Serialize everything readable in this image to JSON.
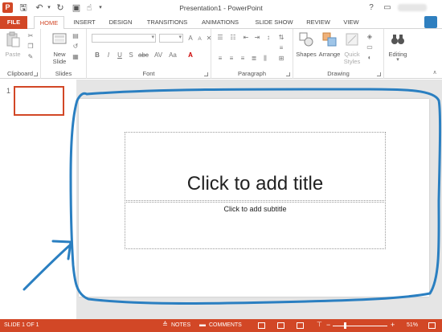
{
  "window": {
    "title": "Presentation1 - PowerPoint",
    "help": "?"
  },
  "quick_access": [
    "save-icon",
    "undo-icon",
    "redo-icon",
    "start-from-beginning-icon",
    "touch-mode-icon",
    "customize-icon"
  ],
  "tabs": [
    {
      "label": "FILE"
    },
    {
      "label": "HOME"
    },
    {
      "label": "INSERT"
    },
    {
      "label": "DESIGN"
    },
    {
      "label": "TRANSITIONS"
    },
    {
      "label": "ANIMATIONS"
    },
    {
      "label": "SLIDE SHOW"
    },
    {
      "label": "REVIEW"
    },
    {
      "label": "VIEW"
    }
  ],
  "ribbon": {
    "clipboard": {
      "label": "Clipboard",
      "paste": "Paste"
    },
    "slides": {
      "label": "Slides",
      "new_slide_line1": "New",
      "new_slide_line2": "Slide"
    },
    "font": {
      "label": "Font",
      "bold": "B",
      "italic": "I",
      "underline": "U",
      "strike": "S",
      "spacing": "AV",
      "case": "Aa",
      "grow": "A",
      "shrink": "A"
    },
    "paragraph": {
      "label": "Paragraph"
    },
    "drawing": {
      "label": "Drawing",
      "shapes": "Shapes",
      "arrange": "Arrange",
      "quick_styles_line1": "Quick",
      "quick_styles_line2": "Styles"
    },
    "editing": {
      "label": "Editing"
    }
  },
  "thumbnail": {
    "number": "1"
  },
  "slide": {
    "title_placeholder": "Click to add title",
    "subtitle_placeholder": "Click to add subtitle"
  },
  "status": {
    "slide_counter": "SLIDE 1 OF 1",
    "notes": "NOTES",
    "comments": "COMMENTS",
    "zoom": "51%",
    "zoom_level_percent": 51,
    "minus": "−",
    "plus": "+"
  },
  "colors": {
    "accent": "#d24726",
    "annotation": "#2a7fc1"
  }
}
